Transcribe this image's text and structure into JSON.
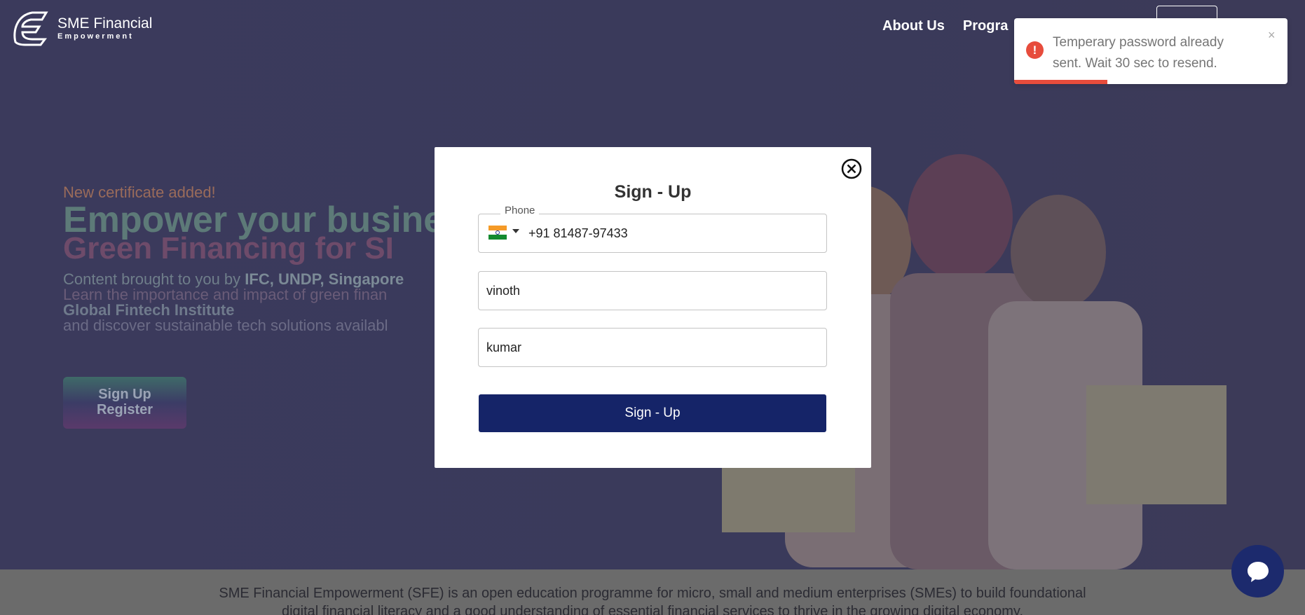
{
  "header": {
    "brand_line1": "SME Financial",
    "brand_line2": "Empowerment",
    "nav": [
      {
        "label": "About Us"
      },
      {
        "label": "Progra"
      }
    ]
  },
  "hero": {
    "badge": "New certificate added!",
    "headline_a": "Empower your busine",
    "headline_b": "Green Financing for SI",
    "line1_prefix": "Content brought to you by ",
    "line1_bold": "IFC, UNDP, Singapore",
    "line2": "Learn the importance and impact of green finan",
    "line3": "Global Fintech Institute",
    "line4": "and discover sustainable tech solutions availabl",
    "button_line1": "Sign Up",
    "button_line2": "Register"
  },
  "modal": {
    "title": "Sign - Up",
    "phone_label": "Phone",
    "phone_value": "+91 81487-97433",
    "first_name_value": "vinoth",
    "last_name_value": "kumar",
    "submit_label": "Sign - Up"
  },
  "toast": {
    "message": "Temperary password already sent. Wait 30 sec to resend.",
    "icon": "!",
    "close": "×",
    "progress": 0.34,
    "color": "#e74c3c"
  },
  "footer_band": {
    "line1": "SME Financial Empowerment (SFE) is an open education programme for micro, small and medium enterprises (SMEs) to build foundational",
    "line2": "digital financial literacy and a good understanding of essential financial services to thrive in the growing digital economy."
  },
  "colors": {
    "accent": "#152468",
    "overlay": "#3a3958",
    "toast_error": "#e74c3c"
  }
}
